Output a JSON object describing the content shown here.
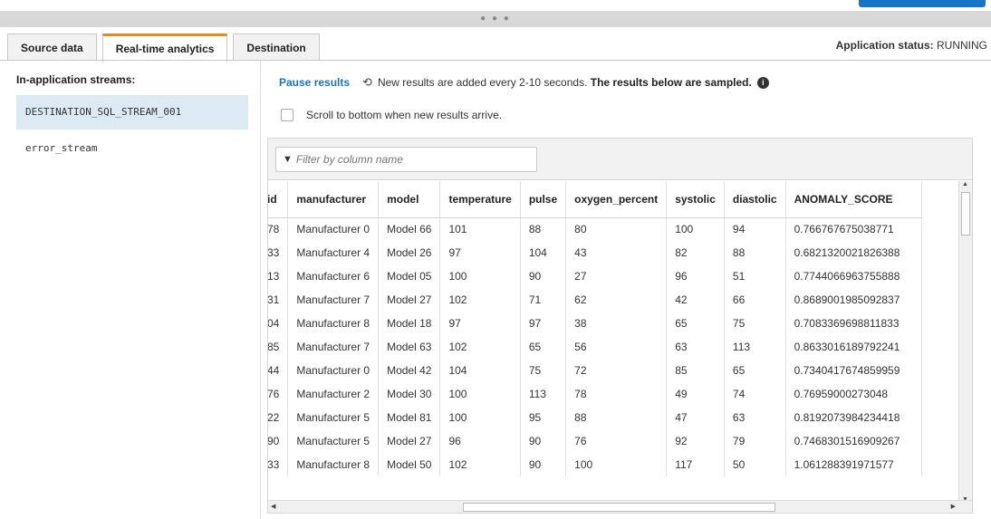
{
  "tabs": [
    {
      "label": "Source data",
      "active": false
    },
    {
      "label": "Real-time analytics",
      "active": true
    },
    {
      "label": "Destination",
      "active": false
    }
  ],
  "app_status": {
    "label": "Application status:",
    "value": "RUNNING"
  },
  "streams": {
    "title": "In-application streams:",
    "items": [
      {
        "label": "DESTINATION_SQL_STREAM_001",
        "selected": true
      },
      {
        "label": "error_stream",
        "selected": false
      }
    ]
  },
  "controls": {
    "pause_label": "Pause results",
    "refresh_icon": "refresh-icon",
    "info_text": "New results are added every 2-10 seconds.",
    "info_bold": "The results below are sampled.",
    "info_icon": "i",
    "scroll_label": "Scroll to bottom when new results arrive."
  },
  "filter": {
    "placeholder": "Filter by column name",
    "icon": "funnel-icon"
  },
  "table": {
    "columns": [
      "id",
      "manufacturer",
      "model",
      "temperature",
      "pulse",
      "oxygen_percent",
      "systolic",
      "diastolic",
      "ANOMALY_SCORE"
    ],
    "rows": [
      [
        "78",
        "Manufacturer 0",
        "Model 66",
        "101",
        "88",
        "80",
        "100",
        "94",
        "0.766767675038771"
      ],
      [
        "33",
        "Manufacturer 4",
        "Model 26",
        "97",
        "104",
        "43",
        "82",
        "88",
        "0.6821320021826388"
      ],
      [
        "13",
        "Manufacturer 6",
        "Model 05",
        "100",
        "90",
        "27",
        "96",
        "51",
        "0.7744066963755888"
      ],
      [
        "31",
        "Manufacturer 7",
        "Model 27",
        "102",
        "71",
        "62",
        "42",
        "66",
        "0.8689001985092837"
      ],
      [
        "04",
        "Manufacturer 8",
        "Model 18",
        "97",
        "97",
        "38",
        "65",
        "75",
        "0.7083369698811833"
      ],
      [
        "85",
        "Manufacturer 7",
        "Model 63",
        "102",
        "65",
        "56",
        "63",
        "113",
        "0.8633016189792241"
      ],
      [
        "44",
        "Manufacturer 0",
        "Model 42",
        "104",
        "75",
        "72",
        "85",
        "65",
        "0.7340417674859959"
      ],
      [
        "76",
        "Manufacturer 2",
        "Model 30",
        "100",
        "113",
        "78",
        "49",
        "74",
        "0.76959000273048"
      ],
      [
        "22",
        "Manufacturer 5",
        "Model 81",
        "100",
        "95",
        "88",
        "47",
        "63",
        "0.8192073984234418"
      ],
      [
        "90",
        "Manufacturer 5",
        "Model 27",
        "96",
        "90",
        "76",
        "92",
        "79",
        "0.7468301516909267"
      ],
      [
        "33",
        "Manufacturer 8",
        "Model 50",
        "102",
        "90",
        "100",
        "117",
        "50",
        "1.061288391971577"
      ]
    ]
  },
  "colors": {
    "accent": "#1a74c6",
    "tab_active": "#e8891d",
    "selected_bg": "#ddeaf6"
  }
}
